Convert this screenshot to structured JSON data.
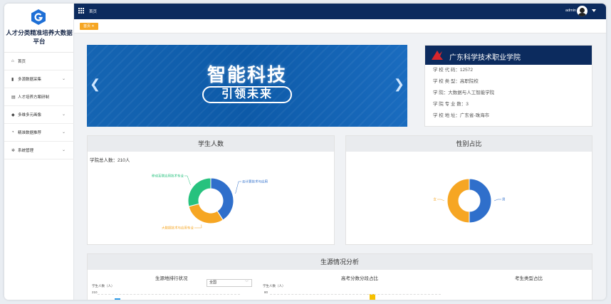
{
  "app": {
    "title": "人才分类精准培养大数据平台"
  },
  "sidebar": {
    "items": [
      {
        "label": "首页",
        "icon": "home-icon",
        "glyph": "⌂",
        "has_children": false
      },
      {
        "label": "多源数据采集",
        "icon": "bar-chart-icon",
        "glyph": "▮",
        "has_children": true
      },
      {
        "label": "人才培养方案研制",
        "icon": "document-icon",
        "glyph": "▤",
        "has_children": false
      },
      {
        "label": "多维多元画像",
        "icon": "graduation-cap-icon",
        "glyph": "◆",
        "has_children": true
      },
      {
        "label": "精准数据推荐",
        "icon": "clock-icon",
        "glyph": "◔",
        "has_children": true
      },
      {
        "label": "系统管理",
        "icon": "gear-icon",
        "glyph": "✲",
        "has_children": true
      }
    ]
  },
  "topbar": {
    "home": "首页",
    "user": "admin"
  },
  "tabs": [
    {
      "label": "首页",
      "close": "✕"
    }
  ],
  "banner": {
    "title": "智能科技",
    "subtitle": "引领未来"
  },
  "school": {
    "name": "广东科学技术职业学院",
    "rows": [
      "学 校 代 码：12572",
      "学 校 类 型：高职院校",
      "学 院：大数据与人工智能学院",
      "学 院 专 业 数：3",
      "学 校 地 址：广东省-珠海市"
    ]
  },
  "students_panel": {
    "title": "学生人数",
    "total": "学院总人数：210人"
  },
  "gender_panel": {
    "title": "性别占比"
  },
  "source_panel": {
    "title": "生源情况分析",
    "sub1": "生源地排行状况",
    "sub2": "高考分数分段占比",
    "sub3": "考生类型占比",
    "ylabel1": "学生人数（人）",
    "ylabel2": "学生人数（人）",
    "select_value": "全国",
    "tick1_top": "210",
    "tick1_mid": "180",
    "tick2_top": "80"
  },
  "chart_data": [
    {
      "type": "pie",
      "title": "学生人数",
      "labels": [
        "云计算技术与应用",
        "大数据技术与应用专业",
        "移动互联应用技术专业"
      ],
      "values": [
        41,
        30,
        29
      ],
      "colors": [
        "#2f6fcb",
        "#f6a623",
        "#27c27e"
      ]
    },
    {
      "type": "pie",
      "title": "性别占比",
      "labels": [
        "男",
        "女"
      ],
      "values": [
        50,
        50
      ],
      "colors": [
        "#2f6fcb",
        "#f6a623"
      ]
    }
  ],
  "colors": {
    "navy": "#0c2b5e",
    "accent": "#f6a623",
    "blue": "#2f6fcb",
    "green": "#27c27e"
  }
}
